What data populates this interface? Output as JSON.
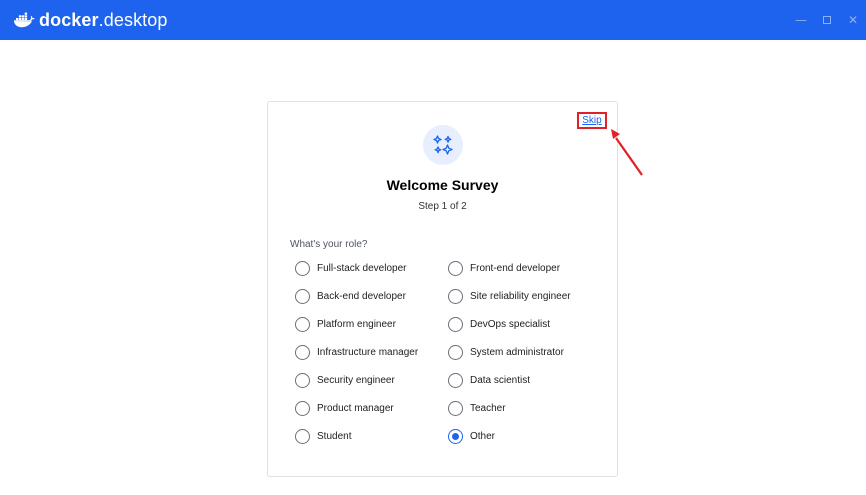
{
  "app": {
    "brand_bold": "docker",
    "brand_light": ".desktop",
    "logo_icon": "docker-whale-icon",
    "window_controls": [
      "minimize-icon",
      "maximize-icon",
      "close-icon"
    ],
    "minimize_glyph": "—",
    "close_glyph": "✕"
  },
  "colors": {
    "titlebar": "#1d63ed",
    "accent": "#1d63ed",
    "annotation": "#e02127"
  },
  "survey": {
    "skip_label": "Skip",
    "icon": "sparkles-icon",
    "title": "Welcome Survey",
    "step": "Step 1 of 2",
    "question": "What's your role?",
    "selected": "Other",
    "options": [
      {
        "label": "Full-stack developer",
        "checked": false
      },
      {
        "label": "Front-end developer",
        "checked": false
      },
      {
        "label": "Back-end developer",
        "checked": false
      },
      {
        "label": "Site reliability engineer",
        "checked": false
      },
      {
        "label": "Platform engineer",
        "checked": false
      },
      {
        "label": "DevOps specialist",
        "checked": false
      },
      {
        "label": "Infrastructure manager",
        "checked": false
      },
      {
        "label": "System administrator",
        "checked": false
      },
      {
        "label": "Security engineer",
        "checked": false
      },
      {
        "label": "Data scientist",
        "checked": false
      },
      {
        "label": "Product manager",
        "checked": false
      },
      {
        "label": "Teacher",
        "checked": false
      },
      {
        "label": "Student",
        "checked": false
      },
      {
        "label": "Other",
        "checked": true
      }
    ]
  }
}
